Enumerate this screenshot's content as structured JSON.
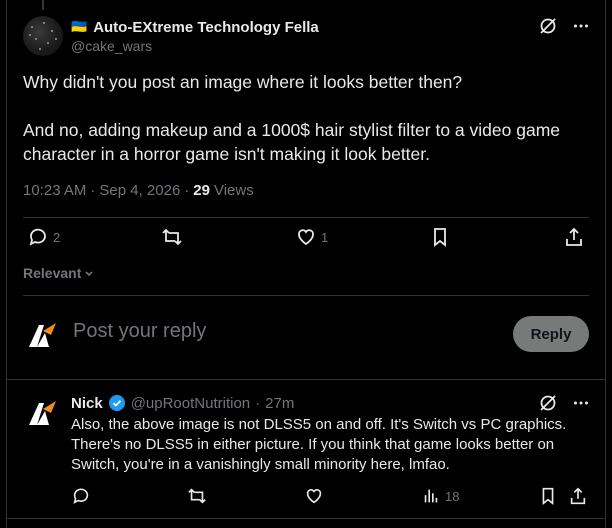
{
  "main_post": {
    "author_flag": "🇺🇦",
    "author_name": "Auto-EXtreme Technology Fella",
    "author_handle": "@cake_wars",
    "paragraph_1": "Why didn't you post an image where it looks better then?",
    "paragraph_2": "And no, adding makeup and a 1000$ hair stylist filter to a video game character in a horror game isn't making it look better.",
    "time": "10:23 AM",
    "dot_1": "·",
    "date": "Sep 4, 2026",
    "dot_2": "·",
    "views_count": "29",
    "views_label": "Views",
    "actions": {
      "replies": "2",
      "reposts": "",
      "likes": "1"
    }
  },
  "sort": {
    "label": "Relevant"
  },
  "composer": {
    "placeholder": "Post your reply",
    "reply_button": "Reply"
  },
  "reply_post": {
    "author_name": "Nick",
    "author_handle": "@upRootNutrition",
    "dot": "·",
    "time": "27m",
    "text": "Also, the above image is not DLSS5 on and off. It's Switch vs PC graphics. There's no DLSS5 in either picture. If you think that game looks better on Switch, you're in a vanishingly small minority here, lmfao.",
    "actions": {
      "views": "18"
    }
  },
  "colors": {
    "background": "#000000",
    "text": "#e7e9ea",
    "muted": "#71767b",
    "verified": "#1d9bf0",
    "logo_orange": "#f28c1b"
  }
}
